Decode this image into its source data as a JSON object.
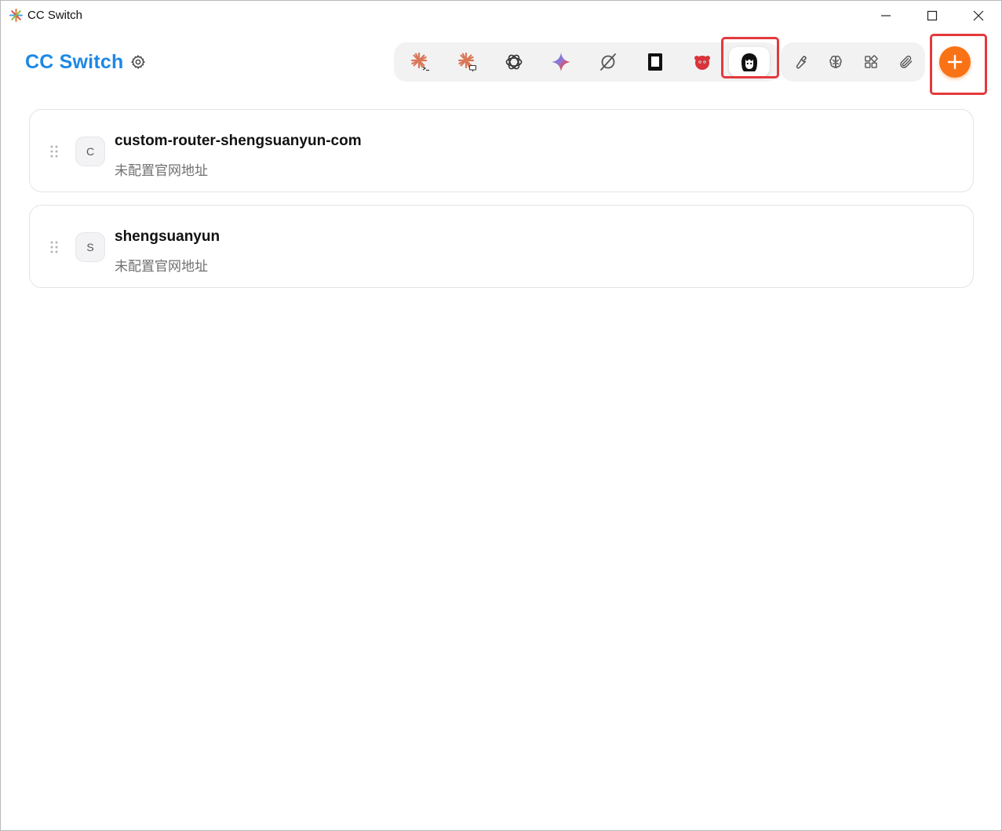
{
  "window": {
    "title": "CC Switch"
  },
  "header": {
    "app_title": "CC Switch"
  },
  "app_tabs": [
    {
      "icon": "claude-code-icon"
    },
    {
      "icon": "claude-desktop-icon"
    },
    {
      "icon": "openai-codex-icon"
    },
    {
      "icon": "gemini-icon"
    },
    {
      "icon": "opencode-icon"
    },
    {
      "icon": "terminal-app-icon"
    },
    {
      "icon": "mascot-app-icon"
    },
    {
      "icon": "anime-girl-app-icon",
      "active": true
    }
  ],
  "tools": [
    {
      "icon": "wrench-icon"
    },
    {
      "icon": "brain-icon"
    },
    {
      "icon": "apps-grid-icon"
    },
    {
      "icon": "paperclip-icon"
    }
  ],
  "providers": [
    {
      "avatar": "C",
      "name": "custom-router-shengsuanyun-com",
      "url": "未配置官网地址"
    },
    {
      "avatar": "S",
      "name": "shengsuanyun",
      "url": "未配置官网地址"
    }
  ],
  "colors": {
    "accent": "#1e88e5",
    "add_button": "#f97316",
    "highlight": "#e5393d"
  }
}
